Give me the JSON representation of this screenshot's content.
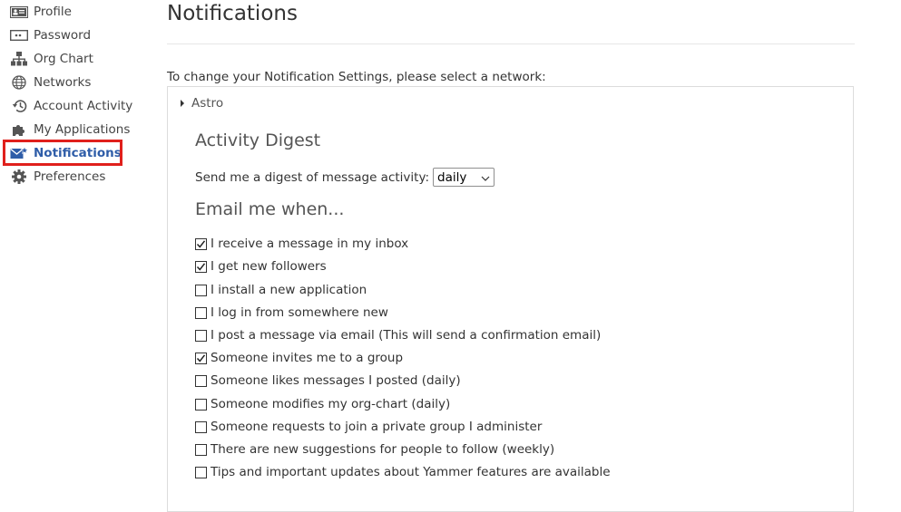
{
  "sidebar": {
    "items": [
      {
        "label": "Profile",
        "icon": "id-card-icon",
        "active": false
      },
      {
        "label": "Password",
        "icon": "password-icon",
        "active": false
      },
      {
        "label": "Org Chart",
        "icon": "org-chart-icon",
        "active": false
      },
      {
        "label": "Networks",
        "icon": "globe-icon",
        "active": false
      },
      {
        "label": "Account Activity",
        "icon": "history-icon",
        "active": false
      },
      {
        "label": "My Applications",
        "icon": "puzzle-icon",
        "active": false
      },
      {
        "label": "Notifications",
        "icon": "envelope-star-icon",
        "active": true
      },
      {
        "label": "Preferences",
        "icon": "gear-icon",
        "active": false
      }
    ]
  },
  "main": {
    "title": "Notifications",
    "network_prompt": "To change your Notification Settings, please select a network:",
    "network_name": "Astro",
    "activity_digest": {
      "heading": "Activity Digest",
      "label": "Send me a digest of message activity:",
      "selected": "daily"
    },
    "email_heading": "Email me when...",
    "email_options": [
      {
        "label": "I receive a message in my inbox",
        "checked": true
      },
      {
        "label": "I get new followers",
        "checked": true
      },
      {
        "label": "I install a new application",
        "checked": false
      },
      {
        "label": "I log in from somewhere new",
        "checked": false
      },
      {
        "label": "I post a message via email (This will send a confirmation email)",
        "checked": false
      },
      {
        "label": "Someone invites me to a group",
        "checked": true
      },
      {
        "label": "Someone likes messages I posted (daily)",
        "checked": false
      },
      {
        "label": "Someone modifies my org-chart (daily)",
        "checked": false
      },
      {
        "label": "Someone requests to join a private group I administer",
        "checked": false
      },
      {
        "label": "There are new suggestions for people to follow (weekly)",
        "checked": false
      },
      {
        "label": "Tips and important updates about Yammer features are available",
        "checked": false
      }
    ]
  },
  "colors": {
    "active_nav": "#2f5da8",
    "highlight": "#e0201c"
  }
}
